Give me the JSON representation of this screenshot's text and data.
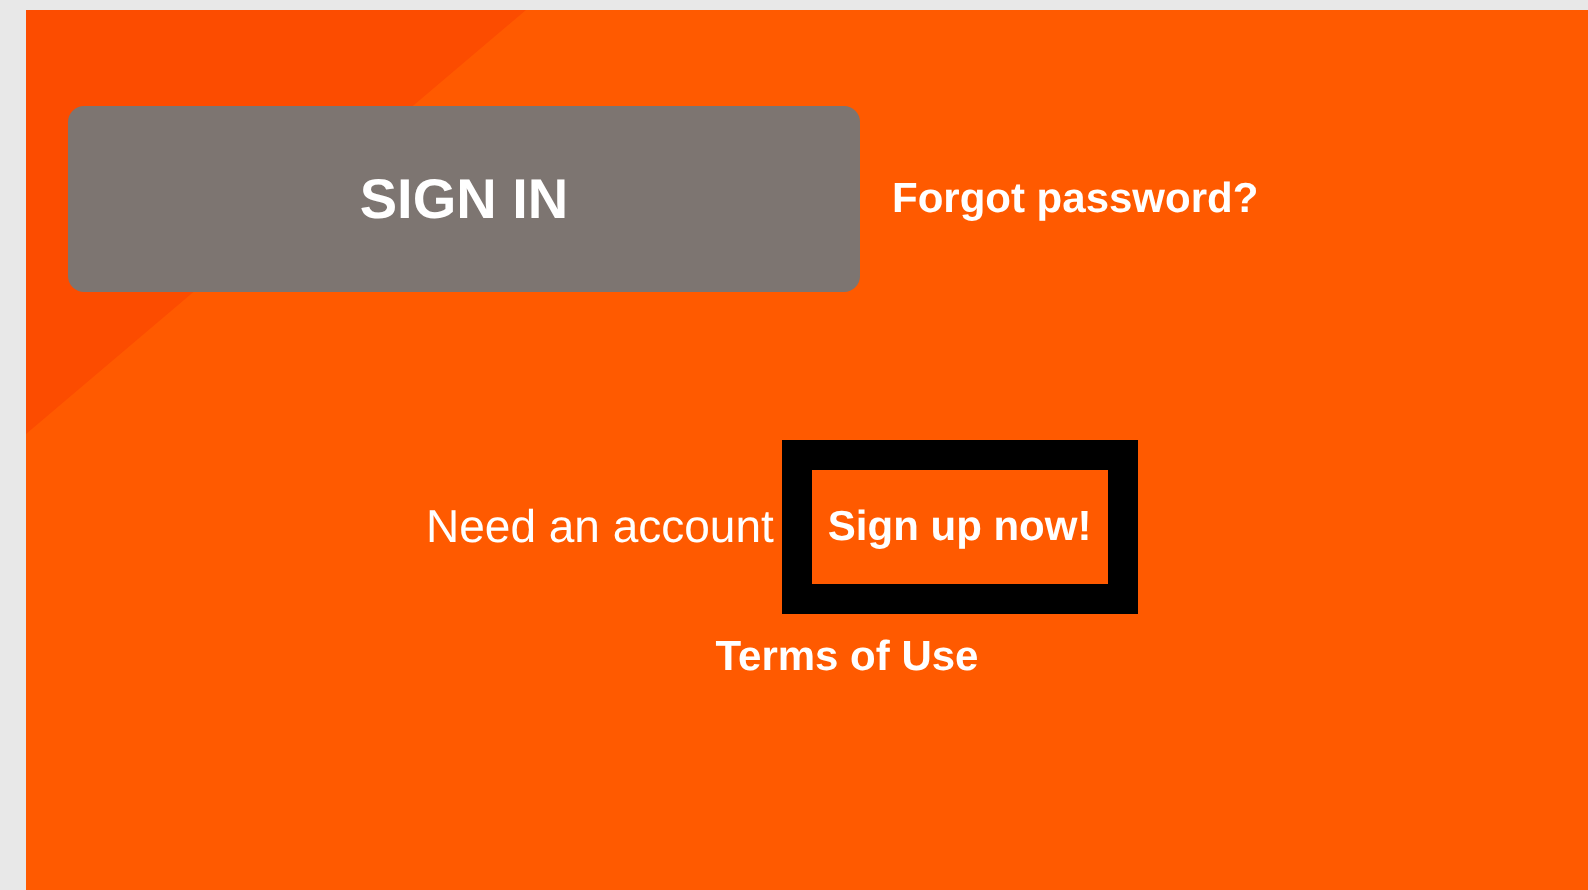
{
  "sign_in_button": "SIGN IN",
  "forgot_password_link": "Forgot password?",
  "signup_prompt": "Need an account",
  "signup_link": {
    "label": "Sign up now!",
    "highlighted": true
  },
  "terms_link": "Terms of Use"
}
